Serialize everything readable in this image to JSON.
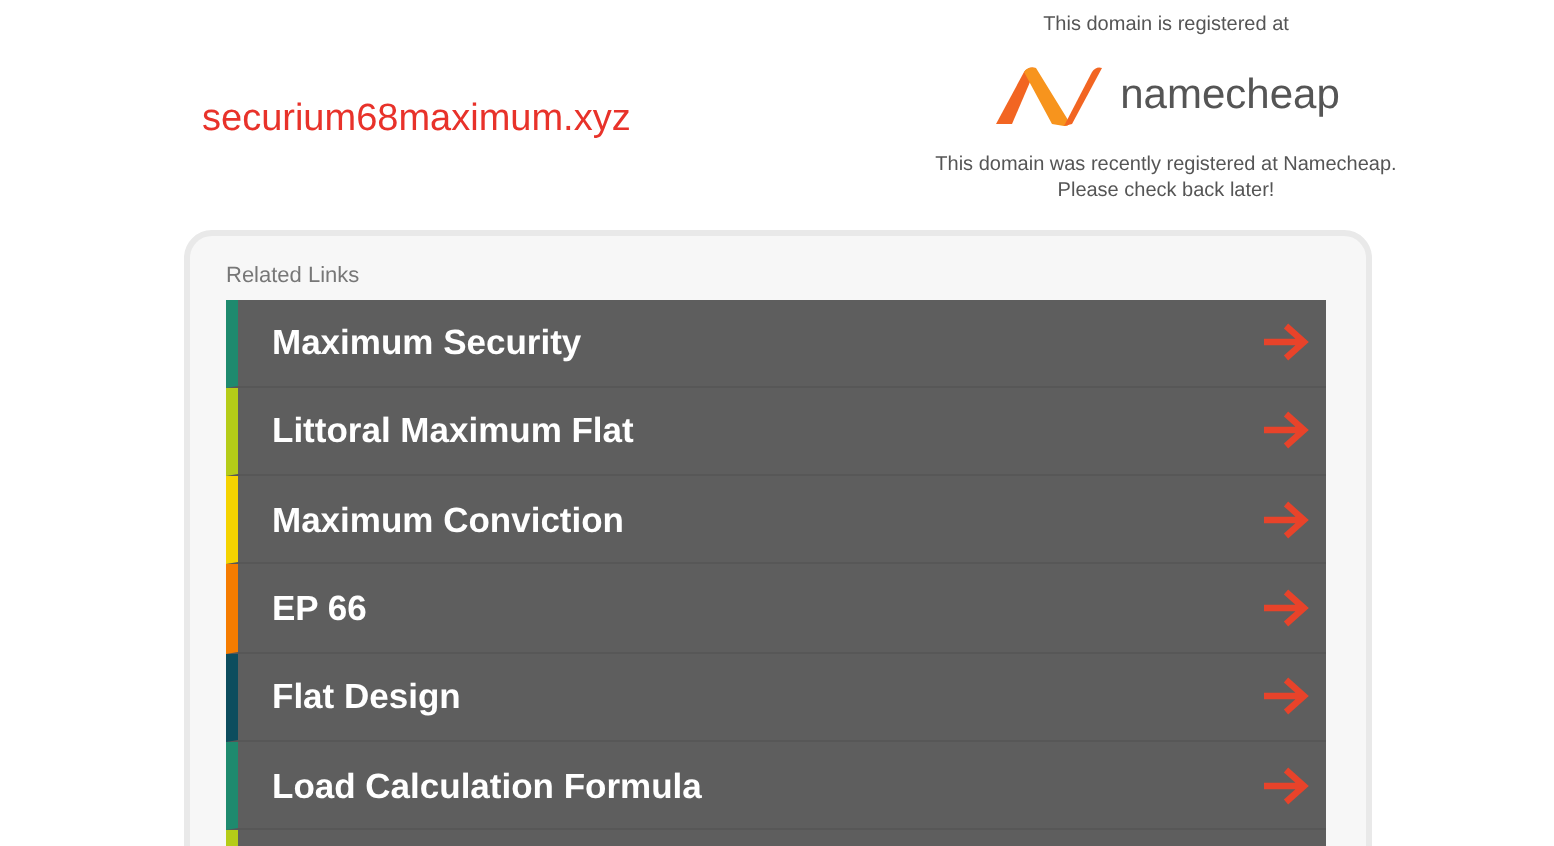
{
  "domain": "securium68maximum.xyz",
  "registrar": {
    "intro": "This domain is registered at",
    "logo_text": "namecheap",
    "message": "This domain was recently registered at Namecheap.",
    "message_2": "Please check back later!"
  },
  "related_links": {
    "heading": "Related Links",
    "items": [
      {
        "label": "Maximum Security",
        "color": "#1e8a6e"
      },
      {
        "label": "Littoral Maximum Flat",
        "color": "#b5cc18"
      },
      {
        "label": "Maximum Conviction",
        "color": "#f5d300"
      },
      {
        "label": "EP 66",
        "color": "#f57c00"
      },
      {
        "label": "Flat Design",
        "color": "#0d4d5e"
      },
      {
        "label": "Load Calculation Formula",
        "color": "#1e8a6e"
      },
      {
        "color": "#b5cc18"
      }
    ]
  }
}
